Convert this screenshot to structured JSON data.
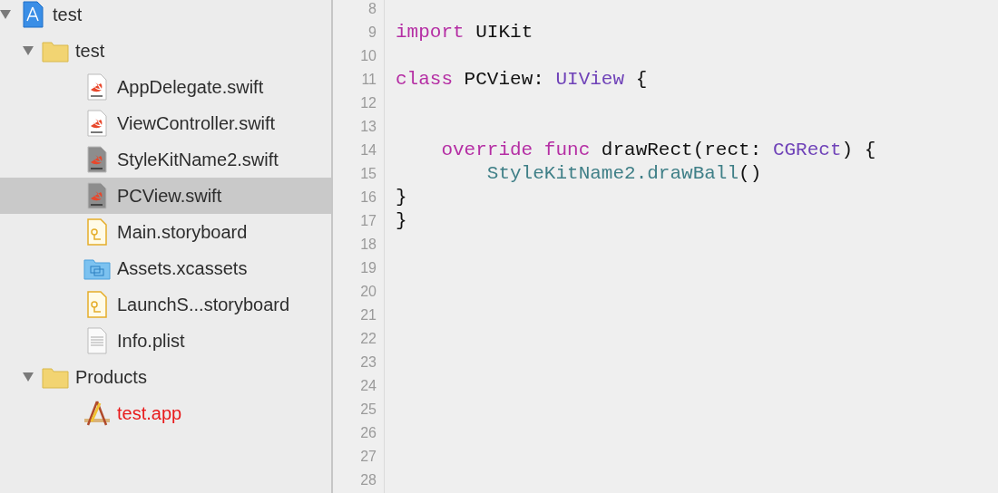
{
  "navigator": {
    "items": [
      {
        "label": "test",
        "kind": "project",
        "expanded": true,
        "selected": false,
        "missing": false,
        "children": [
          {
            "label": "test",
            "kind": "folder",
            "expanded": true,
            "selected": false,
            "missing": false,
            "children": [
              {
                "label": "AppDelegate.swift",
                "kind": "swift",
                "selected": false,
                "missing": false
              },
              {
                "label": "ViewController.swift",
                "kind": "swift",
                "selected": false,
                "missing": false
              },
              {
                "label": "StyleKitName2.swift",
                "kind": "swift_dim",
                "selected": false,
                "missing": false
              },
              {
                "label": "PCView.swift",
                "kind": "swift_dim",
                "selected": true,
                "missing": false
              },
              {
                "label": "Main.storyboard",
                "kind": "storyboard",
                "selected": false,
                "missing": false
              },
              {
                "label": "Assets.xcassets",
                "kind": "assets",
                "selected": false,
                "missing": false
              },
              {
                "label": "LaunchS...storyboard",
                "kind": "storyboard",
                "selected": false,
                "missing": false
              },
              {
                "label": "Info.plist",
                "kind": "plist",
                "selected": false,
                "missing": false
              }
            ]
          },
          {
            "label": "Products",
            "kind": "folder",
            "expanded": true,
            "selected": false,
            "missing": false,
            "children": [
              {
                "label": "test.app",
                "kind": "app",
                "selected": false,
                "missing": true
              }
            ]
          }
        ]
      }
    ]
  },
  "editor": {
    "lines": [
      {
        "number": "8"
      },
      {
        "number": "9",
        "tokens": [
          {
            "text": "import",
            "kind": "keyword"
          },
          {
            "text": " UIKit",
            "kind": "plain"
          }
        ]
      },
      {
        "number": "10"
      },
      {
        "number": "11",
        "tokens": [
          {
            "text": "class",
            "kind": "keyword"
          },
          {
            "text": " PCView: ",
            "kind": "plain"
          },
          {
            "text": "UIView",
            "kind": "type"
          },
          {
            "text": " {",
            "kind": "plain"
          }
        ]
      },
      {
        "number": "12"
      },
      {
        "number": "13"
      },
      {
        "number": "14",
        "tokens": [
          {
            "text": "    override func",
            "kind": "keyword"
          },
          {
            "text": " drawRect(rect: ",
            "kind": "plain"
          },
          {
            "text": "CGRect",
            "kind": "type"
          },
          {
            "text": ") {",
            "kind": "plain"
          }
        ]
      },
      {
        "number": "15",
        "tokens": [
          {
            "text": "        StyleKitName2.drawBall",
            "kind": "project"
          },
          {
            "text": "()",
            "kind": "plain"
          }
        ]
      },
      {
        "number": "16",
        "tokens": [
          {
            "text": "}",
            "kind": "plain"
          }
        ]
      },
      {
        "number": "17",
        "tokens": [
          {
            "text": "}",
            "kind": "plain"
          }
        ]
      },
      {
        "number": "18"
      },
      {
        "number": "19"
      },
      {
        "number": "20"
      },
      {
        "number": "21"
      },
      {
        "number": "22"
      },
      {
        "number": "23"
      },
      {
        "number": "24"
      },
      {
        "number": "25"
      },
      {
        "number": "26"
      },
      {
        "number": "27"
      },
      {
        "number": "28"
      }
    ]
  }
}
